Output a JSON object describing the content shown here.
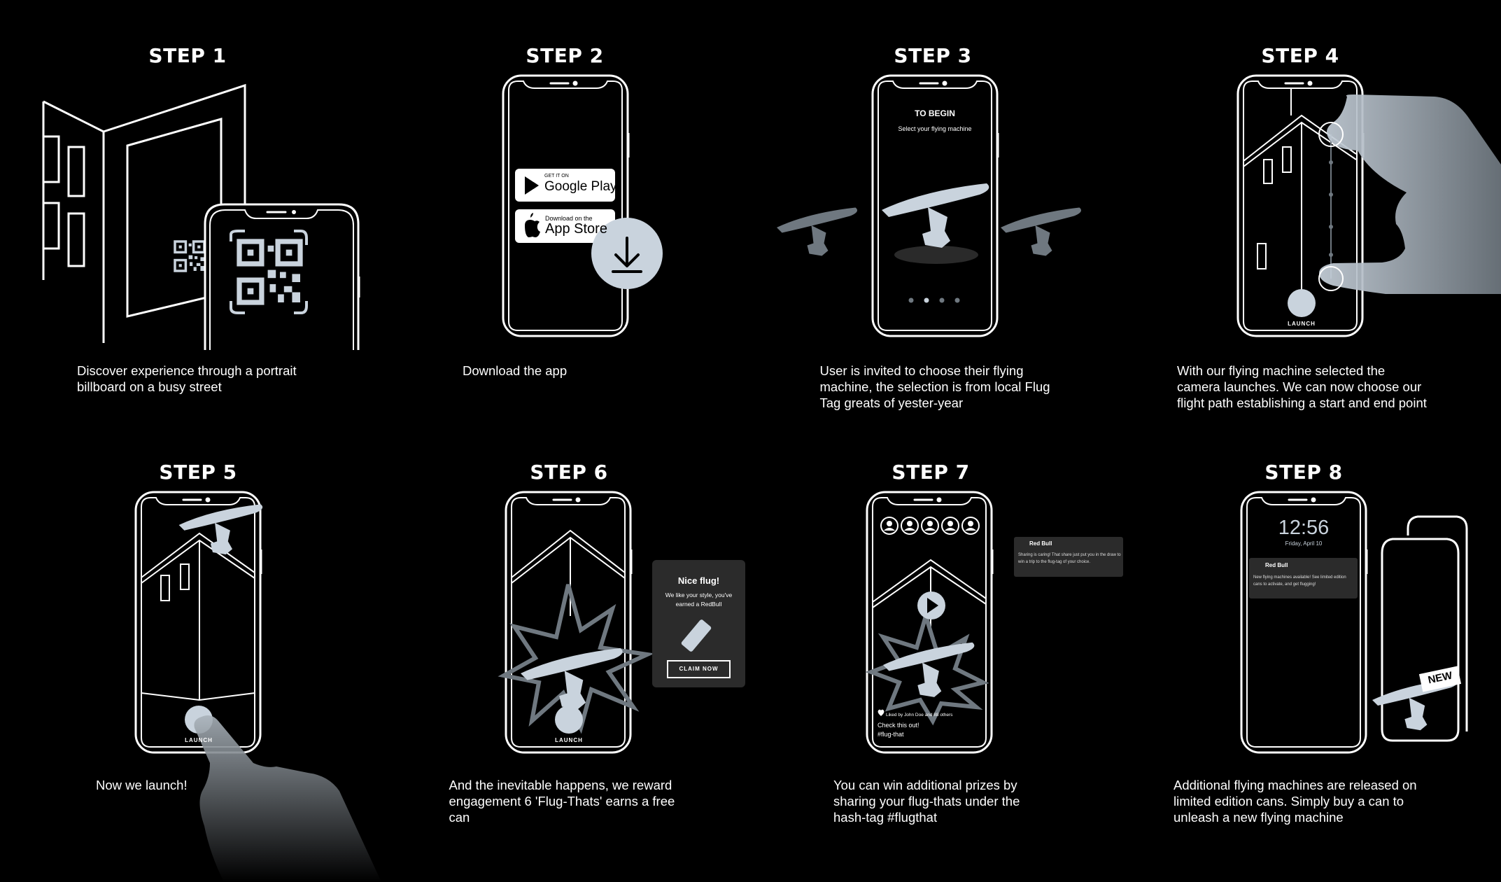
{
  "steps": [
    {
      "title": "STEP 1",
      "caption": "Discover experience through a portrait billboard on a busy street"
    },
    {
      "title": "STEP 2",
      "caption": "Download the app"
    },
    {
      "title": "STEP 3",
      "caption": "User is invited to choose their flying machine, the selection is from local Flug Tag greats of yester-year"
    },
    {
      "title": "STEP 4",
      "caption": "With our flying machine selected the camera launches. We can now choose our flight path establishing a start and end point"
    },
    {
      "title": "STEP 5",
      "caption": "Now we launch!"
    },
    {
      "title": "STEP 6",
      "caption": "And the inevitable happens, we reward engagement 6 'Flug-Thats' earns a free can"
    },
    {
      "title": "STEP 7",
      "caption": "You can win additional prizes by sharing  your flug-thats under the hash-tag #flugthat"
    },
    {
      "title": "STEP 8",
      "caption": "Additional flying machines are released on limited edition cans. Simply buy a can to unleash a new flying machine"
    }
  ],
  "step2": {
    "google_small": "GET IT ON",
    "google_big": "Google Play",
    "apple_small": "Download on the",
    "apple_big": "App Store",
    "download_icon": "download-arrow-icon"
  },
  "step3": {
    "heading": "TO BEGIN",
    "subheading": "Select your flying machine"
  },
  "step4": {
    "launch": "LAUNCH"
  },
  "step5": {
    "launch": "LAUNCH"
  },
  "step6": {
    "popup_title": "Nice flug!",
    "popup_text": "We like your style, you've earned a RedBull",
    "claim": "CLAIM NOW",
    "launch": "LAUNCH"
  },
  "step7": {
    "notif_brand": "Red Bull",
    "notif_text": "Sharing is caring! That share just put you in the draw to win a trip to the flug-tag of your choice.",
    "liked": "Liked by John Doe and 88 others",
    "post_line1": "Check this out!",
    "post_line2": "#flug-that"
  },
  "step8": {
    "time": "12:56",
    "date": "Friday, April 10",
    "notif_brand": "Red Bull",
    "notif_text": "New flying machines available! See limited edition cans to activate, and get flugging!",
    "badge": "NEW"
  },
  "colors": {
    "background": "#000000",
    "line": "#ffffff",
    "accent": "#c9d3dd",
    "panel": "#2b2b2b"
  }
}
